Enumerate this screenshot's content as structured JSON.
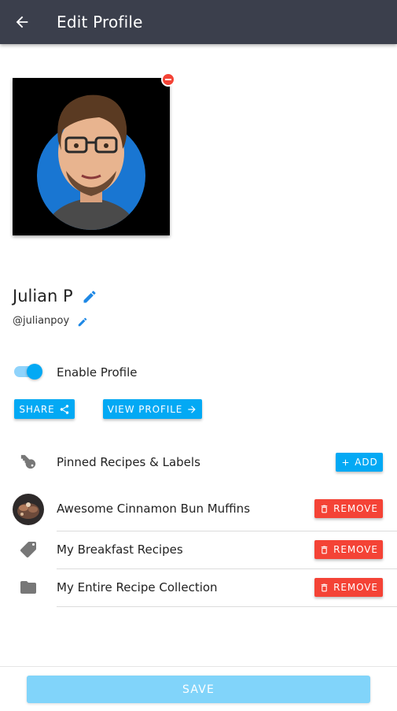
{
  "header": {
    "title": "Edit Profile",
    "back_icon": "arrow-left-icon"
  },
  "profile": {
    "name": "Julian P",
    "handle": "@julianpoy"
  },
  "toggle": {
    "label": "Enable Profile",
    "enabled": true
  },
  "buttons": {
    "share": "SHARE",
    "view_profile": "VIEW PROFILE",
    "add": "ADD",
    "save": "SAVE"
  },
  "pinned": {
    "title": "Pinned Recipes & Labels",
    "items": [
      {
        "label": "Awesome Cinnamon Bun Muffins",
        "icon": "recipe-thumbnail",
        "action": "REMOVE"
      },
      {
        "label": "My Breakfast Recipes",
        "icon": "label-tag-icon",
        "action": "REMOVE"
      },
      {
        "label": "My Entire Recipe Collection",
        "icon": "folder-icon",
        "action": "REMOVE"
      }
    ]
  },
  "colors": {
    "appbar": "#3b3f4c",
    "accent": "#03a9f4",
    "danger": "#f44336",
    "save_disabled": "#81d4fa"
  }
}
